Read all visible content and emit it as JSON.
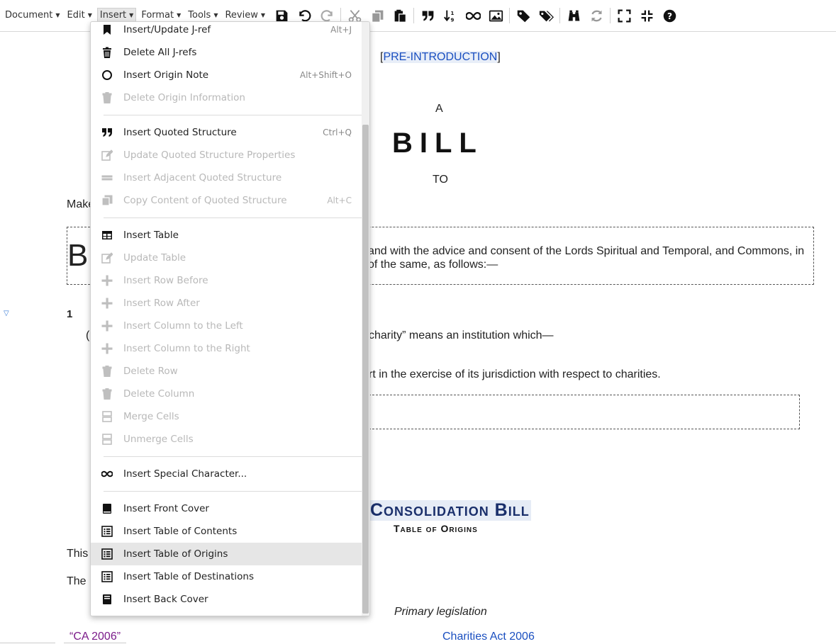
{
  "toolbar": {
    "menus": [
      {
        "label": "Document"
      },
      {
        "label": "Edit"
      },
      {
        "label": "Insert"
      },
      {
        "label": "Format"
      },
      {
        "label": "Tools"
      },
      {
        "label": "Review"
      }
    ],
    "icons": [
      "save-icon",
      "undo-icon",
      "redo-icon",
      "cut-icon",
      "copy-icon",
      "paste-icon",
      "quote-icon",
      "sort-icon",
      "infinity-icon",
      "image-icon",
      "tag-icon",
      "tags-icon",
      "binoculars-icon",
      "refresh-icon",
      "fullscreen-icon",
      "exit-fullscreen-icon",
      "help-icon"
    ]
  },
  "document": {
    "pre_intro_open": "[",
    "pre_intro_label": "PRE-INTRODUCTION",
    "pre_intro_close": "]",
    "a_text": "A",
    "bill_text": "BILL",
    "to_text": "TO",
    "make_fragment": "Make",
    "enact_initial": "B",
    "enact_text": "and with the advice and consent of the Lords Spiritual and Temporal, and Commons, in of the same, as follows:—",
    "section_number": "1",
    "section_paren": "(",
    "charity_text": "charity” means an institution which—",
    "court_text": "rt in the exercise of its jurisdiction with respect to charities.",
    "consolidation_title": "Consolidation Bill",
    "table_of_origins_subtitle": "Table of Origins",
    "this_fragment": "This",
    "the_fragment": "The",
    "primary_legislation": "Primary legislation",
    "ca_ref": "“CA 2006”",
    "ca_link": "Charities Act 2006"
  },
  "insert_menu": {
    "items": [
      {
        "label": "Insert/Update J-ref",
        "shortcut": "Alt+J",
        "icon": "bookmark-icon",
        "disabled": false
      },
      {
        "label": "Delete All J-refs",
        "shortcut": "",
        "icon": "trash-icon",
        "disabled": false
      },
      {
        "label": "Insert Origin Note",
        "shortcut": "Alt+Shift+O",
        "icon": "circle-icon",
        "disabled": false
      },
      {
        "label": "Delete Origin Information",
        "shortcut": "",
        "icon": "trash-icon",
        "disabled": true
      },
      {
        "label": "Insert Quoted Structure",
        "shortcut": "Ctrl+Q",
        "icon": "quote-icon",
        "disabled": false
      },
      {
        "label": "Update Quoted Structure Properties",
        "shortcut": "",
        "icon": "edit-icon",
        "disabled": true
      },
      {
        "label": "Insert Adjacent Quoted Structure",
        "shortcut": "",
        "icon": "equals-icon",
        "disabled": true
      },
      {
        "label": "Copy Content of Quoted Structure",
        "shortcut": "Alt+C",
        "icon": "copy-icon",
        "disabled": true
      },
      {
        "label": "Insert Table",
        "shortcut": "",
        "icon": "table-icon",
        "disabled": false
      },
      {
        "label": "Update Table",
        "shortcut": "",
        "icon": "edit-icon",
        "disabled": true
      },
      {
        "label": "Insert Row Before",
        "shortcut": "",
        "icon": "plus-icon",
        "disabled": true
      },
      {
        "label": "Insert Row After",
        "shortcut": "",
        "icon": "plus-icon",
        "disabled": true
      },
      {
        "label": "Insert Column to the Left",
        "shortcut": "",
        "icon": "plus-icon",
        "disabled": true
      },
      {
        "label": "Insert Column to the Right",
        "shortcut": "",
        "icon": "plus-icon",
        "disabled": true
      },
      {
        "label": "Delete Row",
        "shortcut": "",
        "icon": "trash-icon",
        "disabled": true
      },
      {
        "label": "Delete Column",
        "shortcut": "",
        "icon": "trash-icon",
        "disabled": true
      },
      {
        "label": "Merge Cells",
        "shortcut": "",
        "icon": "merge-icon",
        "disabled": true
      },
      {
        "label": "Unmerge Cells",
        "shortcut": "",
        "icon": "merge-icon",
        "disabled": true
      },
      {
        "label": "Insert Special Character...",
        "shortcut": "",
        "icon": "infinity-icon",
        "disabled": false
      },
      {
        "label": "Insert Front Cover",
        "shortcut": "",
        "icon": "book-icon",
        "disabled": false
      },
      {
        "label": "Insert Table of Contents",
        "shortcut": "",
        "icon": "list-icon",
        "disabled": false
      },
      {
        "label": "Insert Table of Origins",
        "shortcut": "",
        "icon": "list-icon",
        "disabled": false
      },
      {
        "label": "Insert Table of Destinations",
        "shortcut": "",
        "icon": "list-icon",
        "disabled": false
      },
      {
        "label": "Insert Back Cover",
        "shortcut": "",
        "icon": "book-back-icon",
        "disabled": false
      }
    ],
    "hovered_item": "Insert Table of Origins"
  },
  "colors": {
    "link_blue": "#1a4fc0",
    "title_navy": "#1a2f6b",
    "ref_purple": "#7b1b8a",
    "hover_grey": "#e6e6e6",
    "disabled_grey": "#b8b8b8"
  }
}
